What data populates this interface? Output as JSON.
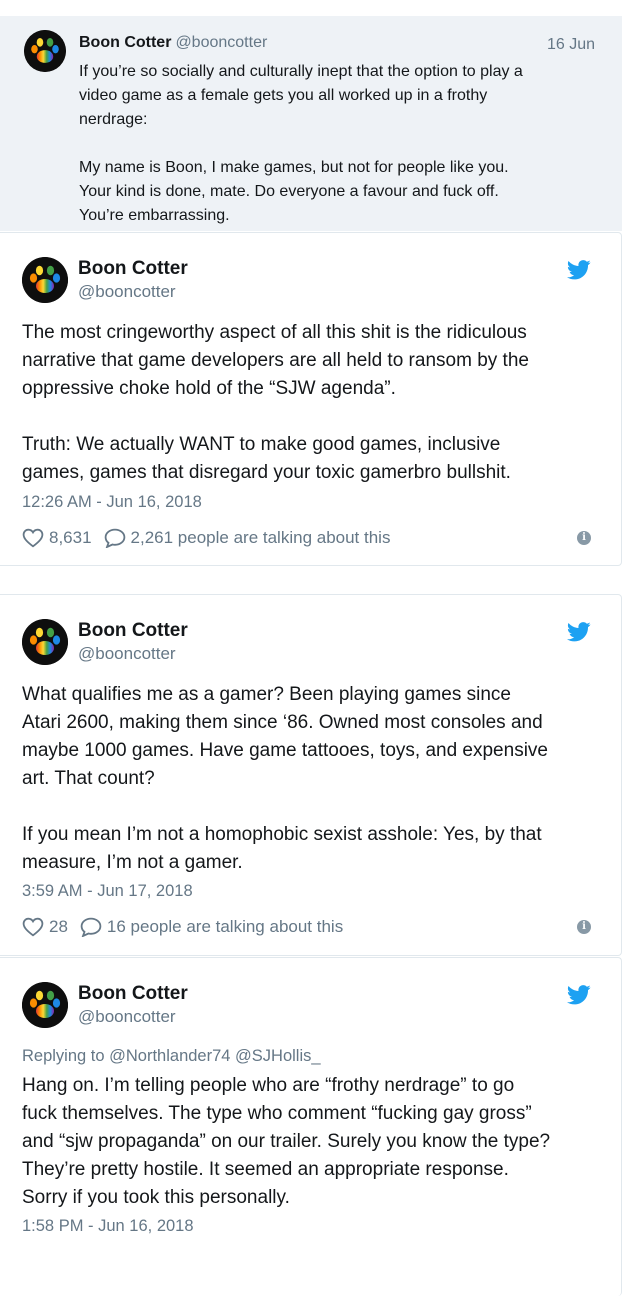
{
  "quoted_tweet": {
    "author_name": "Boon Cotter",
    "author_handle": "@booncotter",
    "date": "16 Jun",
    "text": "If you’re so socially and culturally inept that the option to play a\nvideo game as a female gets you all worked up in a frothy\nnerdrage:\n\nMy name is Boon, I make games, but not for people like you.\nYour kind is done, mate. Do everyone a favour and fuck off.\nYou’re embarrassing."
  },
  "tweets": [
    {
      "author_name": "Boon Cotter",
      "author_handle": "@booncotter",
      "text": "The most cringeworthy aspect of all this shit is the ridiculous\nnarrative that game developers are all held to ransom by the\noppressive choke hold of the “SJW agenda”.\n\nTruth: We actually WANT to make good games, inclusive\ngames, games that disregard your toxic gamerbro bullshit.",
      "timestamp": "12:26 AM - Jun 16, 2018",
      "likes": "8,631",
      "talking": "2,261 people are talking about this"
    },
    {
      "author_name": "Boon Cotter",
      "author_handle": "@booncotter",
      "text": "What qualifies me as a gamer? Been playing games since\nAtari 2600, making them since ‘86. Owned most consoles and\nmaybe 1000 games. Have game tattooes, toys, and expensive\nart. That count?\n\nIf you mean I’m not a homophobic sexist asshole: Yes, by that\nmeasure, I’m not a gamer.",
      "timestamp": "3:59 AM - Jun 17, 2018",
      "likes": "28",
      "talking": "16 people are talking about this"
    },
    {
      "author_name": "Boon Cotter",
      "author_handle": "@booncotter",
      "replying_to": "Replying to @Northlander74 @SJHollis_",
      "text": "Hang on. I’m telling people who are “frothy nerdrage” to go\nfuck themselves. The type who comment “fucking gay gross”\nand “sjw propaganda” on our trailer. Surely you know the type?\nThey’re pretty hostile. It seemed an appropriate response.\nSorry if you took this personally.",
      "timestamp": "1:58 PM - Jun 16, 2018"
    }
  ],
  "colors": {
    "twitter_blue": "#1da1f2",
    "secondary_text": "#657786",
    "quoted_background": "#eef2f6"
  },
  "icons": [
    "paw-avatar",
    "twitter-bird-icon",
    "heart-icon",
    "reply-bubble-icon",
    "info-icon"
  ]
}
